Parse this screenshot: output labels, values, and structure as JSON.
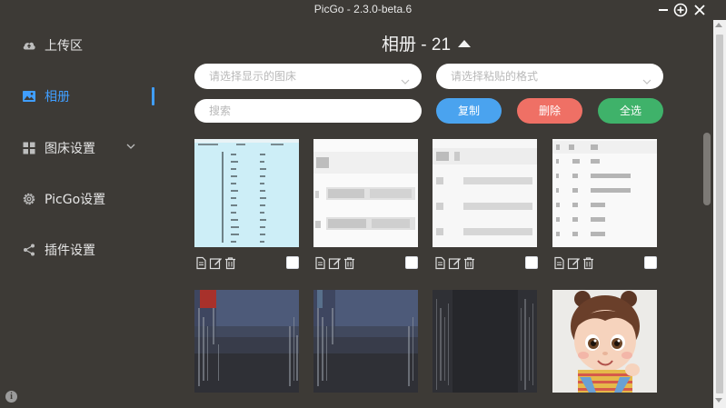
{
  "window": {
    "title": "PicGo - 2.3.0-beta.6",
    "controls": [
      "minimize-icon",
      "plus-circle-icon",
      "close-icon"
    ]
  },
  "sidebar": {
    "items": [
      {
        "label": "上传区",
        "icon": "cloud-upload-icon",
        "active": false
      },
      {
        "label": "相册",
        "icon": "image-icon",
        "active": true
      },
      {
        "label": "图床设置",
        "icon": "grid-icon",
        "active": false,
        "expandable": true
      },
      {
        "label": "PicGo设置",
        "icon": "gear-icon",
        "active": false
      },
      {
        "label": "插件设置",
        "icon": "share-icon",
        "active": false
      }
    ],
    "info_icon": "i"
  },
  "gallery": {
    "title": "相册 - 21",
    "bed_select_placeholder": "请选择显示的图床",
    "format_select_placeholder": "请选择粘贴的格式",
    "search_placeholder": "搜索",
    "copy_label": "复制",
    "delete_label": "删除",
    "select_all_label": "全选"
  },
  "colors": {
    "background": "#3d3a36",
    "accent": "#409eff",
    "copy": "#4aa3ef",
    "delete": "#ef7065",
    "select_all": "#3fb26a"
  },
  "images": [
    {
      "kind": "table-cyan",
      "checked": false
    },
    {
      "kind": "table-blurred",
      "checked": false
    },
    {
      "kind": "table-blurred-2",
      "checked": false
    },
    {
      "kind": "table-blurred-3",
      "checked": false
    },
    {
      "kind": "dark-screenshot-red",
      "checked": false
    },
    {
      "kind": "dark-screenshot",
      "checked": false
    },
    {
      "kind": "dark-lines",
      "checked": false
    },
    {
      "kind": "cartoon-girl",
      "checked": false
    }
  ]
}
